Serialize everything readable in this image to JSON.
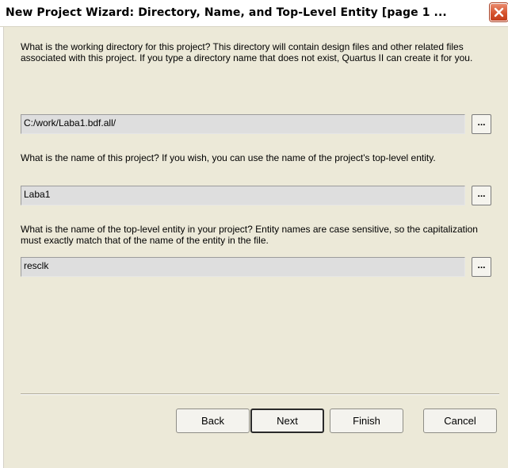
{
  "window": {
    "title": "New Project Wizard: Directory, Name, and Top-Level Entity [page 1 ...",
    "close_icon": "close-x-icon"
  },
  "questions": [
    {
      "text": "What is the working directory for this project?  This directory will contain design files and other related files associated with this project.  If you type a directory name that does not exist, Quartus II can create it for you.",
      "value": "C:/work/Laba1.bdf.all/",
      "browse_label": "..."
    },
    {
      "text": "What is the name of this project?  If you wish, you can use the name of the project's top-level entity.",
      "value": "Laba1",
      "browse_label": "..."
    },
    {
      "text": "What is the name of the top-level entity in your project?  Entity names are case sensitive, so the capitalization must exactly match that of the name of the entity in the file.",
      "value": "resclk",
      "browse_label": "..."
    }
  ],
  "buttons": {
    "back": "Back",
    "next": "Next",
    "finish": "Finish",
    "cancel": "Cancel"
  },
  "colors": {
    "dialog_bg": "#ece9d8",
    "close_button": "#d4502a",
    "field_bg": "#dedede"
  }
}
